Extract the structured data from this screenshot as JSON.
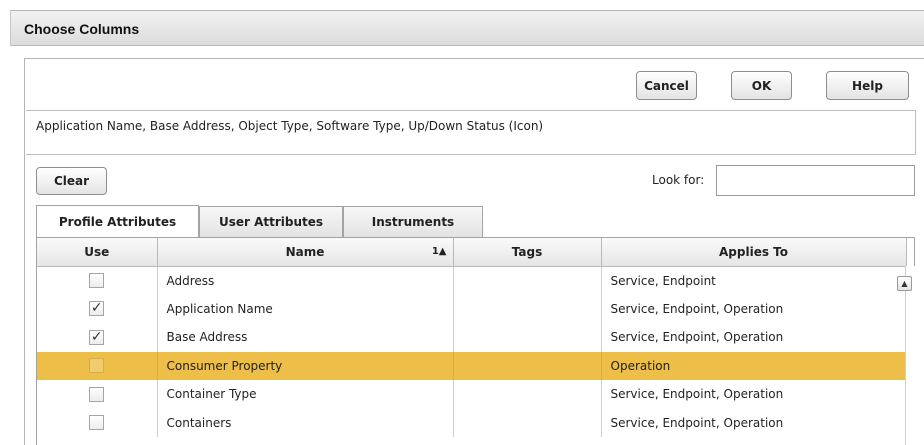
{
  "dialog": {
    "title": "Choose Columns"
  },
  "buttons": {
    "cancel": "Cancel",
    "ok": "OK",
    "help": "Help",
    "clear": "Clear"
  },
  "summary": "Application Name, Base Address, Object Type, Software Type, Up/Down Status (Icon)",
  "search": {
    "label": "Look for:",
    "value": ""
  },
  "tabs": [
    {
      "label": "Profile Attributes",
      "active": true
    },
    {
      "label": "User Attributes",
      "active": false
    },
    {
      "label": "Instruments",
      "active": false
    }
  ],
  "grid": {
    "columns": {
      "use": "Use",
      "name": "Name",
      "sort": "1▲",
      "tags": "Tags",
      "applies_to": "Applies To"
    },
    "rows": [
      {
        "checked": false,
        "name": "Address",
        "tags": "",
        "applies_to": "Service, Endpoint",
        "selected": false
      },
      {
        "checked": true,
        "name": "Application Name",
        "tags": "",
        "applies_to": "Service, Endpoint, Operation",
        "selected": false
      },
      {
        "checked": true,
        "name": "Base Address",
        "tags": "",
        "applies_to": "Service, Endpoint, Operation",
        "selected": false
      },
      {
        "checked": false,
        "name": "Consumer Property",
        "tags": "",
        "applies_to": "Operation",
        "selected": true
      },
      {
        "checked": false,
        "name": "Container Type",
        "tags": "",
        "applies_to": "Service, Endpoint, Operation",
        "selected": false
      },
      {
        "checked": false,
        "name": "Containers",
        "tags": "",
        "applies_to": "Service, Endpoint, Operation",
        "selected": false
      }
    ]
  },
  "colors": {
    "selected_row": "#edbf48"
  }
}
